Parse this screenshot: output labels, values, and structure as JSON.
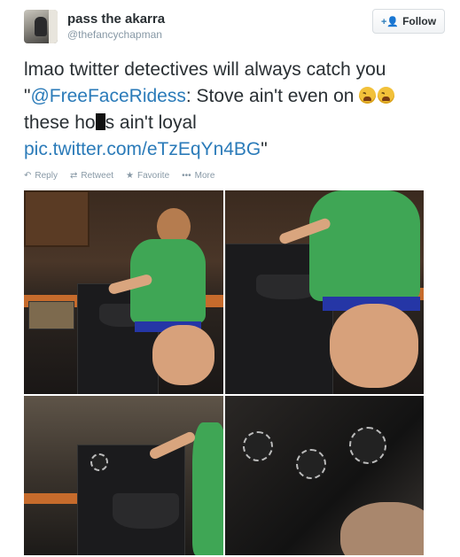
{
  "tweet": {
    "name": "pass the akarra",
    "handle": "@thefancychapman",
    "follow_label": "Follow",
    "text_part1": "lmao twitter detectives will always catch you \"",
    "mention": "@FreeFaceRidess",
    "text_part2": ": Stove ain't even on ",
    "text_part3": " these ho",
    "text_part4": "s ain't loyal",
    "link": "pic.twitter.com/eTzEqYn4BG",
    "text_end": "\"",
    "emoji_icon": "tired-face-icon"
  },
  "actions": [
    {
      "label": "Reply",
      "icon": "reply-icon"
    },
    {
      "label": "Retweet",
      "icon": "retweet-icon"
    },
    {
      "label": "Favorite",
      "icon": "star-icon"
    },
    {
      "label": "More",
      "icon": "more-dots-icon"
    }
  ],
  "colors": {
    "link": "#2b7bb9",
    "meta": "#8899a6",
    "shirt": "#3fa655",
    "counter": "#c66b2c"
  }
}
